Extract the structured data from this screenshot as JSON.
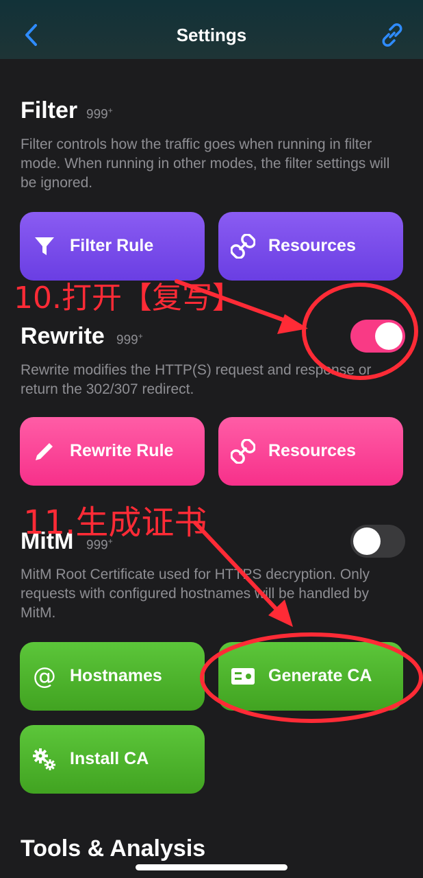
{
  "nav": {
    "title": "Settings",
    "back_icon": "chevron-left-icon",
    "link_icon": "link-icon",
    "accent": "#2f8cff"
  },
  "filter": {
    "title": "Filter",
    "badge": "999",
    "badge_plus": "+",
    "description": "Filter controls how the traffic goes when running in filter mode. When running in other modes, the filter settings will be ignored.",
    "buttons": [
      {
        "label": "Filter Rule",
        "icon": "funnel-icon"
      },
      {
        "label": "Resources",
        "icon": "link-icon"
      }
    ],
    "color": "#7b4ded"
  },
  "rewrite": {
    "title": "Rewrite",
    "badge": "999",
    "badge_plus": "+",
    "toggle_on": true,
    "description": "Rewrite modifies the HTTP(S) request and response or return the 302/307 redirect.",
    "buttons": [
      {
        "label": "Rewrite Rule",
        "icon": "pencil-icon"
      },
      {
        "label": "Resources",
        "icon": "link-icon"
      }
    ],
    "color": "#f93a85"
  },
  "mitm": {
    "title": "MitM",
    "badge": "999",
    "badge_plus": "+",
    "toggle_on": false,
    "description": "MitM Root Certificate used for HTTPS decryption. Only requests with configured hostnames will be handled by MitM.",
    "buttons": [
      {
        "label": "Hostnames",
        "icon": "at-icon"
      },
      {
        "label": "Generate CA",
        "icon": "id-card-icon"
      },
      {
        "label": "Install CA",
        "icon": "gears-icon"
      }
    ],
    "color": "#4db52b"
  },
  "tools": {
    "title": "Tools & Analysis"
  },
  "annotations": {
    "step10": "10.打开【复写】",
    "step11": "11.生成证书",
    "color": "#ff2b36"
  }
}
